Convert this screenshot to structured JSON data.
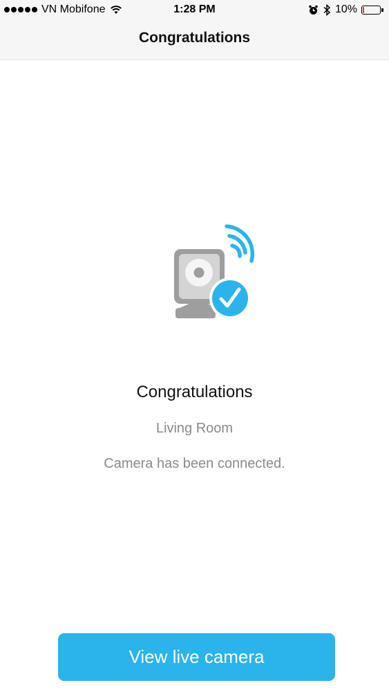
{
  "status_bar": {
    "carrier": "VN Mobifone",
    "time": "1:28 PM",
    "battery_percent": "10%",
    "battery_level": 0.1,
    "icons": [
      "signal-dots-icon",
      "wifi-icon",
      "alarm-icon",
      "bluetooth-icon",
      "battery-icon"
    ]
  },
  "nav": {
    "title": "Congratulations"
  },
  "content": {
    "illustration_icon": "camera-connected-icon",
    "title": "Congratulations",
    "camera_name": "Living Room",
    "message": "Camera has been connected."
  },
  "actions": {
    "primary_label": "View live camera"
  },
  "colors": {
    "accent": "#2bb3ec",
    "camera_gray": "#9e9e9e",
    "secondary_text": "#8a8a8e"
  }
}
